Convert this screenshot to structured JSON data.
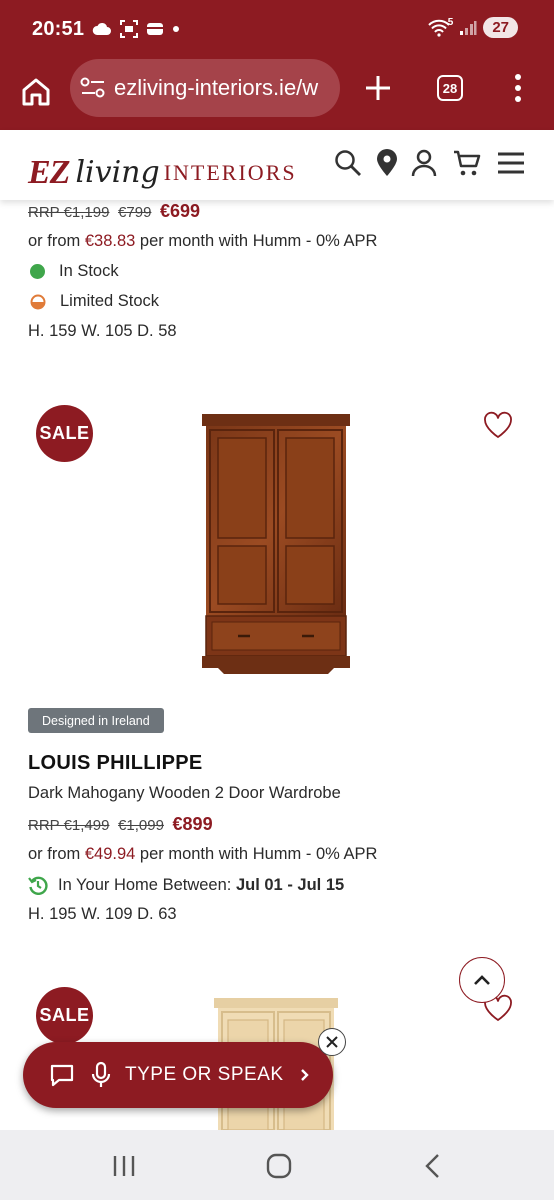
{
  "status_bar": {
    "time": "20:51",
    "battery": "27",
    "signal_label": "5"
  },
  "browser": {
    "url": "ezliving-interiors.ie/w",
    "tab_count": "28"
  },
  "site": {
    "logo_ez": "EZ",
    "logo_living": "living",
    "logo_interiors": "INTERIORS"
  },
  "product1": {
    "rrp": "RRP €1,199",
    "was": "€799",
    "now": "€699",
    "finance_prefix": "or from ",
    "finance_amount": "€38.83",
    "finance_suffix": " per month with Humm - 0% APR",
    "stock_in": "In Stock",
    "stock_limited": "Limited Stock",
    "dimensions": "H. 159  W. 105  D. 58"
  },
  "product2": {
    "sale": "SALE",
    "tag": "Designed in Ireland",
    "title": "LOUIS PHILLIPPE",
    "subtitle": "Dark Mahogany Wooden 2 Door Wardrobe",
    "rrp": "RRP €1,499",
    "was": "€1,099",
    "now": "€899",
    "finance_prefix": "or from ",
    "finance_amount": "€49.94",
    "finance_suffix": " per month with Humm - 0% APR",
    "delivery_prefix": "In Your Home Between: ",
    "delivery_range": "Jul 01 - Jul 15",
    "dimensions": "H. 195  W. 109  D. 63"
  },
  "product3": {
    "sale": "SALE"
  },
  "assistant": {
    "label": "TYPE OR SPEAK"
  },
  "colors": {
    "brand": "#8d1b22",
    "in_stock": "#3fa64b",
    "limited_stock": "#e07b39",
    "tag_bg": "#6e757b"
  }
}
